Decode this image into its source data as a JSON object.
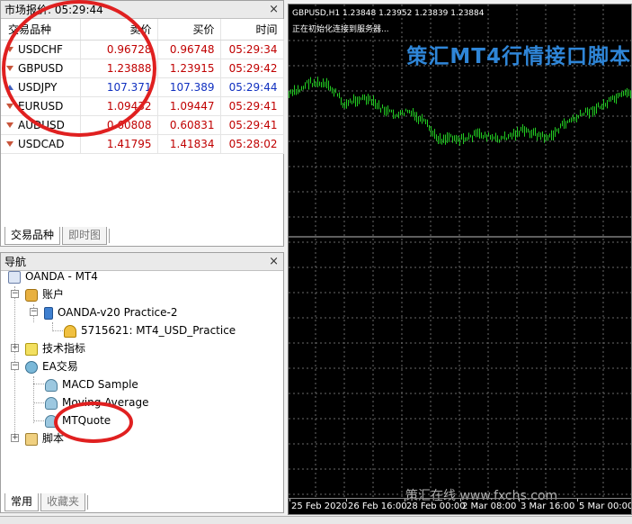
{
  "market_watch": {
    "title": "市场报价: 05:29:44",
    "columns": [
      "交易品种",
      "卖价",
      "买价",
      "时间"
    ],
    "rows": [
      {
        "symbol": "USDCHF",
        "bid": "0.96728",
        "ask": "0.96748",
        "time": "05:29:34",
        "color": "red",
        "dir": "down"
      },
      {
        "symbol": "GBPUSD",
        "bid": "1.23888",
        "ask": "1.23915",
        "time": "05:29:42",
        "color": "red",
        "dir": "down"
      },
      {
        "symbol": "USDJPY",
        "bid": "107.371",
        "ask": "107.389",
        "time": "05:29:44",
        "color": "blue",
        "dir": "up"
      },
      {
        "symbol": "EURUSD",
        "bid": "1.09432",
        "ask": "1.09447",
        "time": "05:29:41",
        "color": "red",
        "dir": "down"
      },
      {
        "symbol": "AUDUSD",
        "bid": "0.60808",
        "ask": "0.60831",
        "time": "05:29:41",
        "color": "red",
        "dir": "down"
      },
      {
        "symbol": "USDCAD",
        "bid": "1.41795",
        "ask": "1.41834",
        "time": "05:28:02",
        "color": "red",
        "dir": "down"
      }
    ],
    "tabs": [
      "交易品种",
      "即时图"
    ]
  },
  "navigator": {
    "title": "导航",
    "root": "OANDA - MT4",
    "accounts": "账户",
    "broker": "OANDA-v20 Practice-2",
    "account": "5715621: MT4_USD_Practice",
    "indicators": "技术指标",
    "expert_advisors": "EA交易",
    "ea_items": [
      "MACD Sample",
      "Moving Average",
      "MTQuote"
    ],
    "scripts": "脚本",
    "tabs": [
      "常用",
      "收藏夹"
    ]
  },
  "chart": {
    "header": "GBPUSD,H1  1.23848 1.23952 1.23839 1.23884",
    "subheader": "正在初始化连接到服务器...",
    "overlay_title": "策汇MT4行情接口脚本",
    "watermark": "策汇在线 www.fxchs.com",
    "line_color": "#22cc22",
    "date_labels": [
      "25 Feb 2020",
      "26 Feb 16:00",
      "28 Feb 00:00",
      "2 Mar 08:00",
      "3 Mar 16:00",
      "5 Mar 00:00"
    ]
  }
}
